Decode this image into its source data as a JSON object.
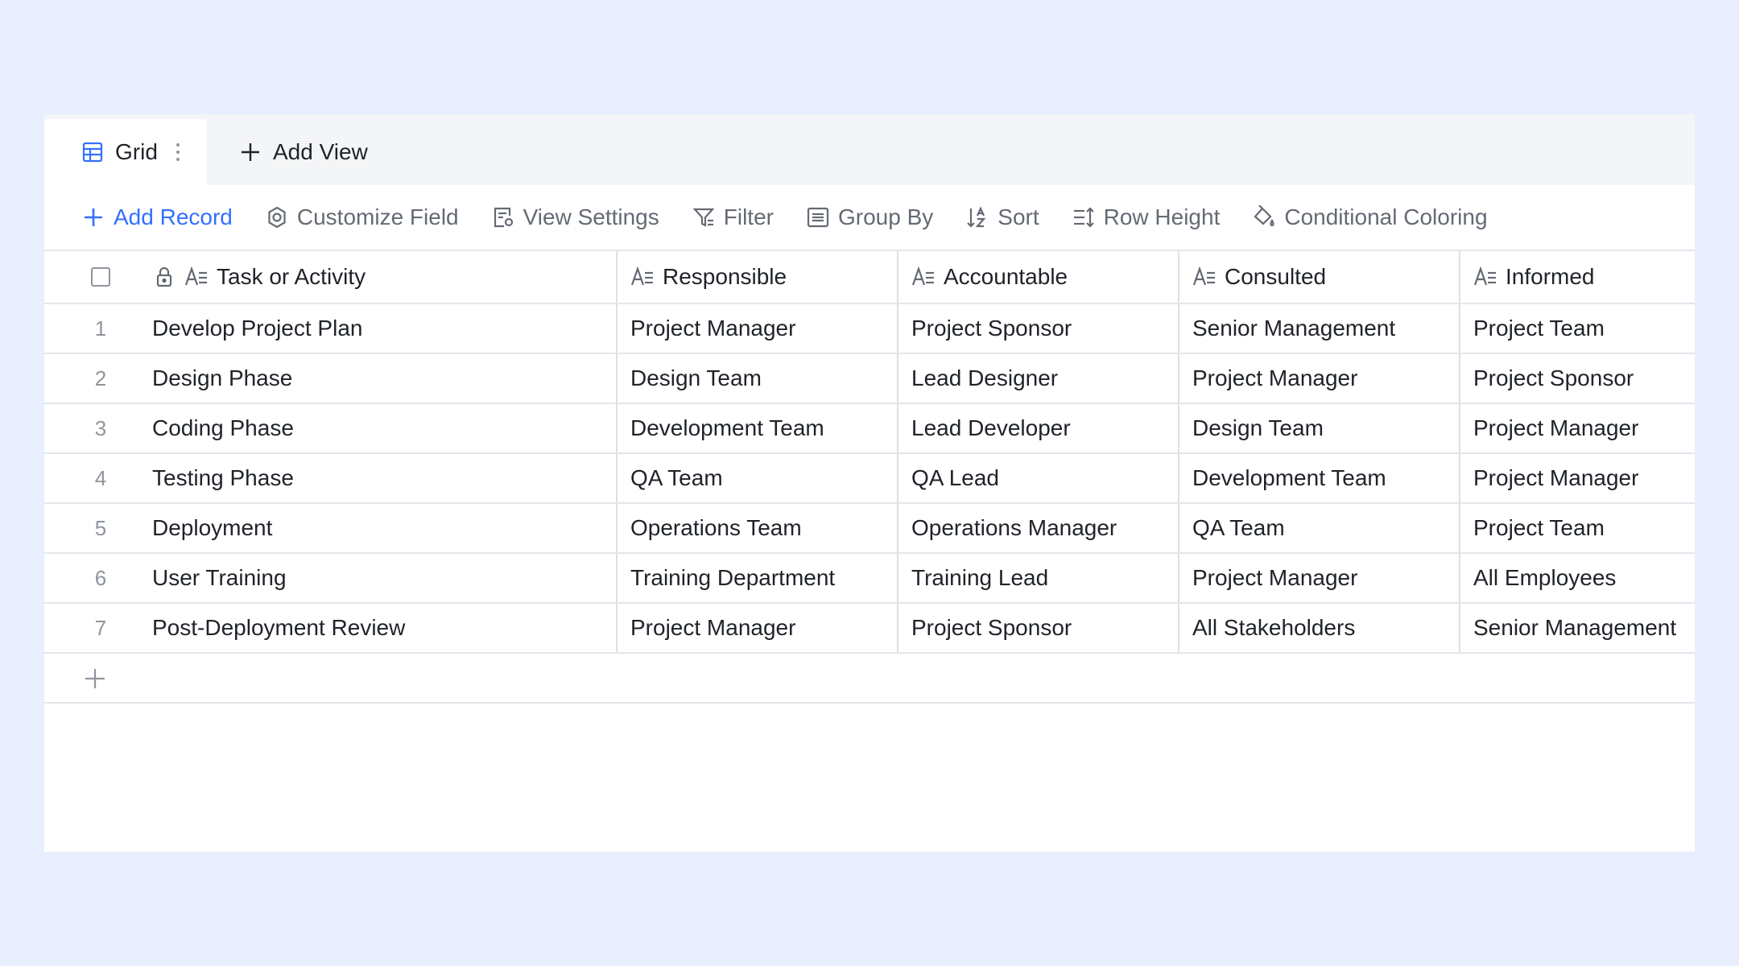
{
  "tabs": {
    "active_label": "Grid",
    "add_view_label": "Add View"
  },
  "toolbar": {
    "add_record": "Add Record",
    "customize_field": "Customize Field",
    "view_settings": "View Settings",
    "filter": "Filter",
    "group_by": "Group By",
    "sort": "Sort",
    "row_height": "Row Height",
    "conditional_coloring": "Conditional Coloring"
  },
  "colors": {
    "accent": "#3370ff",
    "page_background": "#e8eefd"
  },
  "table": {
    "columns": [
      "Task or Activity",
      "Responsible",
      "Accountable",
      "Consulted",
      "Informed"
    ],
    "rows": [
      {
        "index": "1",
        "cells": [
          "Develop Project Plan",
          "Project Manager",
          "Project Sponsor",
          "Senior Management",
          "Project Team"
        ]
      },
      {
        "index": "2",
        "cells": [
          "Design Phase",
          "Design Team",
          "Lead Designer",
          "Project Manager",
          "Project Sponsor"
        ]
      },
      {
        "index": "3",
        "cells": [
          "Coding Phase",
          "Development Team",
          "Lead Developer",
          "Design Team",
          "Project Manager"
        ]
      },
      {
        "index": "4",
        "cells": [
          "Testing Phase",
          "QA Team",
          "QA Lead",
          "Development Team",
          "Project Manager"
        ]
      },
      {
        "index": "5",
        "cells": [
          "Deployment",
          "Operations Team",
          "Operations Manager",
          "QA Team",
          "Project Team"
        ]
      },
      {
        "index": "6",
        "cells": [
          "User Training",
          "Training Department",
          "Training Lead",
          "Project Manager",
          "All Employees"
        ]
      },
      {
        "index": "7",
        "cells": [
          "Post-Deployment Review",
          "Project Manager",
          "Project Sponsor",
          "All Stakeholders",
          "Senior Management"
        ]
      }
    ]
  }
}
